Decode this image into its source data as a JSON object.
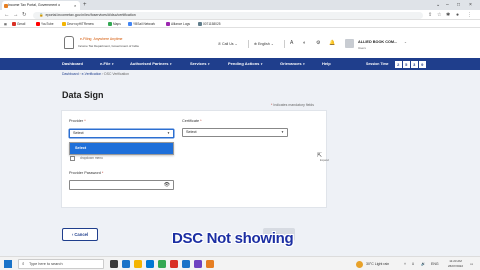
{
  "browser": {
    "tab_title": "Income Tax Portal, Government o",
    "tab_close": "×",
    "new_tab": "+",
    "window_controls": [
      "⌄",
      "–",
      "□",
      "×"
    ],
    "url": "eportal.incometax.gov.in/iec/foservices/#/dsc/certification",
    "bookmarks": [
      "Gmail",
      "YouTube",
      "Dew royHITRenew",
      "Maps",
      "YBSail Network",
      "Alliance Logs",
      "0071158025"
    ],
    "bookmark_colors": [
      "#d93025",
      "#ff0000",
      "#f4b400",
      "#34a853",
      "#4285f4",
      "#9c27b0",
      "#607d8b"
    ]
  },
  "site": {
    "logo_title": "e-Filing",
    "logo_tagline": "Anywhere Anytime",
    "logo_subtitle": "Income Tax Department, Government of India",
    "call_us": "Call Us",
    "language": "English",
    "user_name": "ALLIED BOOK COM...",
    "user_role": "Users"
  },
  "nav": {
    "items": [
      "Dashboard",
      "e-File",
      "Authorised Partners",
      "Services",
      "Pending Actions",
      "Grievances",
      "Help"
    ],
    "session_label": "Session Time",
    "session_digits": [
      "2",
      "5",
      "3",
      "9"
    ]
  },
  "breadcrumb": {
    "home": "Dashboard",
    "middle": "e-Verification",
    "current": "DSC Verification"
  },
  "page": {
    "title": "Data Sign",
    "mandatory_note": "Indicates mandatory fields",
    "provider_label": "Provider",
    "provider_value": "Select",
    "certificate_label": "Certificate",
    "certificate_value": "Select",
    "dropdown_option": "Select",
    "helper_text": "dropdown menu",
    "password_label": "Provider Password",
    "side_note": "Expand",
    "cancel_label": "Cancel",
    "proceed_label": "Sign"
  },
  "caption": "DSC Not showing",
  "taskbar": {
    "search_placeholder": "Type here to search",
    "weather": "30°C  Light rain",
    "time": "11:23 AM",
    "date": "26/07/2022",
    "app_colors": [
      "#3a3a3a",
      "#1a73c8",
      "#f4b400",
      "#0078d4",
      "#34a853",
      "#d93025",
      "#1a73c8",
      "#6f42c1",
      "#e67e22"
    ]
  }
}
